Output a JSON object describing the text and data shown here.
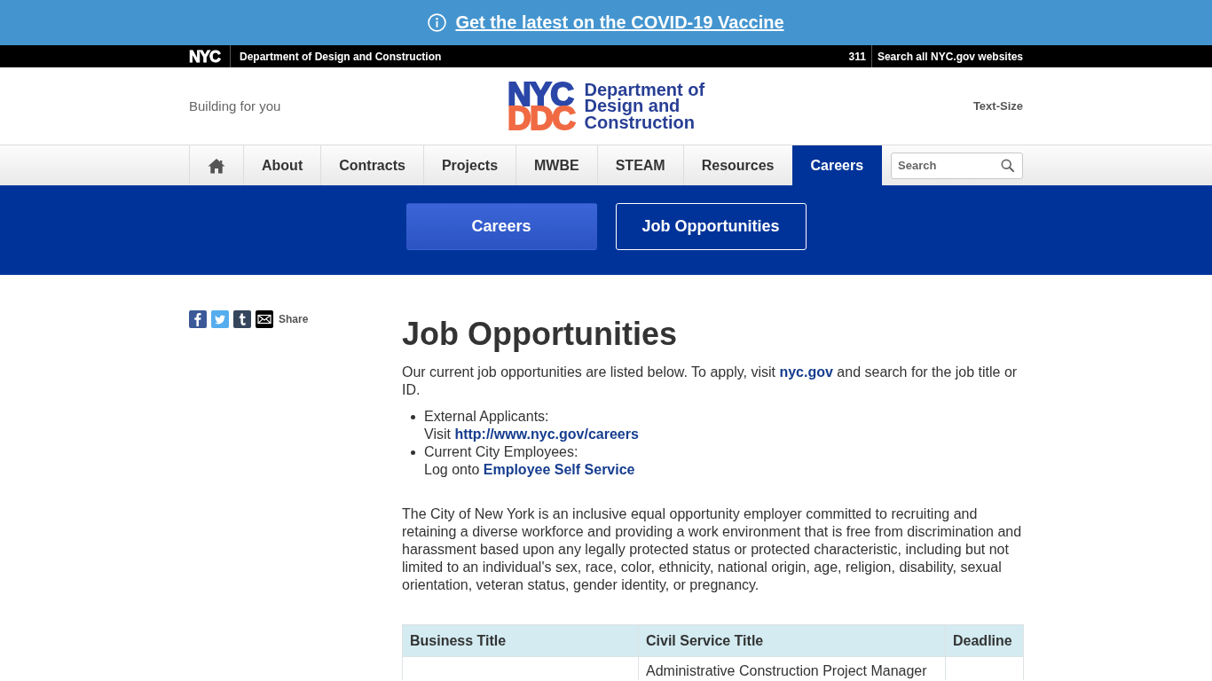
{
  "banner": {
    "text": "Get the latest on the COVID-19 Vaccine"
  },
  "top_bar": {
    "logo": "NYC",
    "agency": "Department of Design and Construction",
    "phone": "311",
    "search_link": "Search all NYC.gov websites"
  },
  "header": {
    "tagline": "Building for you",
    "logo": {
      "top": "NYC",
      "bottom": "DDC",
      "name_lines": [
        "Department of",
        "Design and",
        "Construction"
      ]
    },
    "text_size": "Text-Size"
  },
  "nav": {
    "items": [
      {
        "kind": "home",
        "selected": false
      },
      {
        "kind": "link",
        "label": "About",
        "selected": false
      },
      {
        "kind": "link",
        "label": "Contracts",
        "selected": false
      },
      {
        "kind": "link",
        "label": "Projects",
        "selected": false
      },
      {
        "kind": "link",
        "label": "MWBE",
        "selected": false
      },
      {
        "kind": "link",
        "label": "STEAM",
        "selected": false
      },
      {
        "kind": "link",
        "label": "Resources",
        "selected": false
      },
      {
        "kind": "link",
        "label": "Careers",
        "selected": true
      }
    ],
    "search": {
      "placeholder": "Search"
    }
  },
  "subnav": [
    {
      "label": "Careers",
      "selected": false
    },
    {
      "label": "Job Opportunities",
      "selected": true
    }
  ],
  "share": {
    "label": "Share"
  },
  "page": {
    "title": "Job Opportunities",
    "intro": {
      "before": "Our current job opportunities are listed below. To apply, visit",
      "link": "nyc.gov",
      "after": "and search for the job title or ID."
    },
    "applicant_list": [
      {
        "label": "External Applicants:",
        "prefix": "Visit",
        "link": "http://www.nyc.gov/careers"
      },
      {
        "label": "Current City Employees:",
        "prefix": "Log onto",
        "link": "Employee Self Service"
      }
    ],
    "eeo_statement": "The City of New York is an inclusive equal opportunity employer committed to recruiting and retaining a diverse workforce and providing a work environment that is free from discrimination and harassment based upon any legally protected status or protected characteristic, including but not limited to an individual's sex, race, color, ethnicity, national origin, age, religion, disability, sexual orientation, veteran status, gender identity, or pregnancy.",
    "table": {
      "columns": [
        "Business Title",
        "Civil Service Title",
        "Deadline"
      ],
      "rows": [
        {
          "civil_service_title": "Administrative Construction Project Manager"
        }
      ]
    }
  }
}
